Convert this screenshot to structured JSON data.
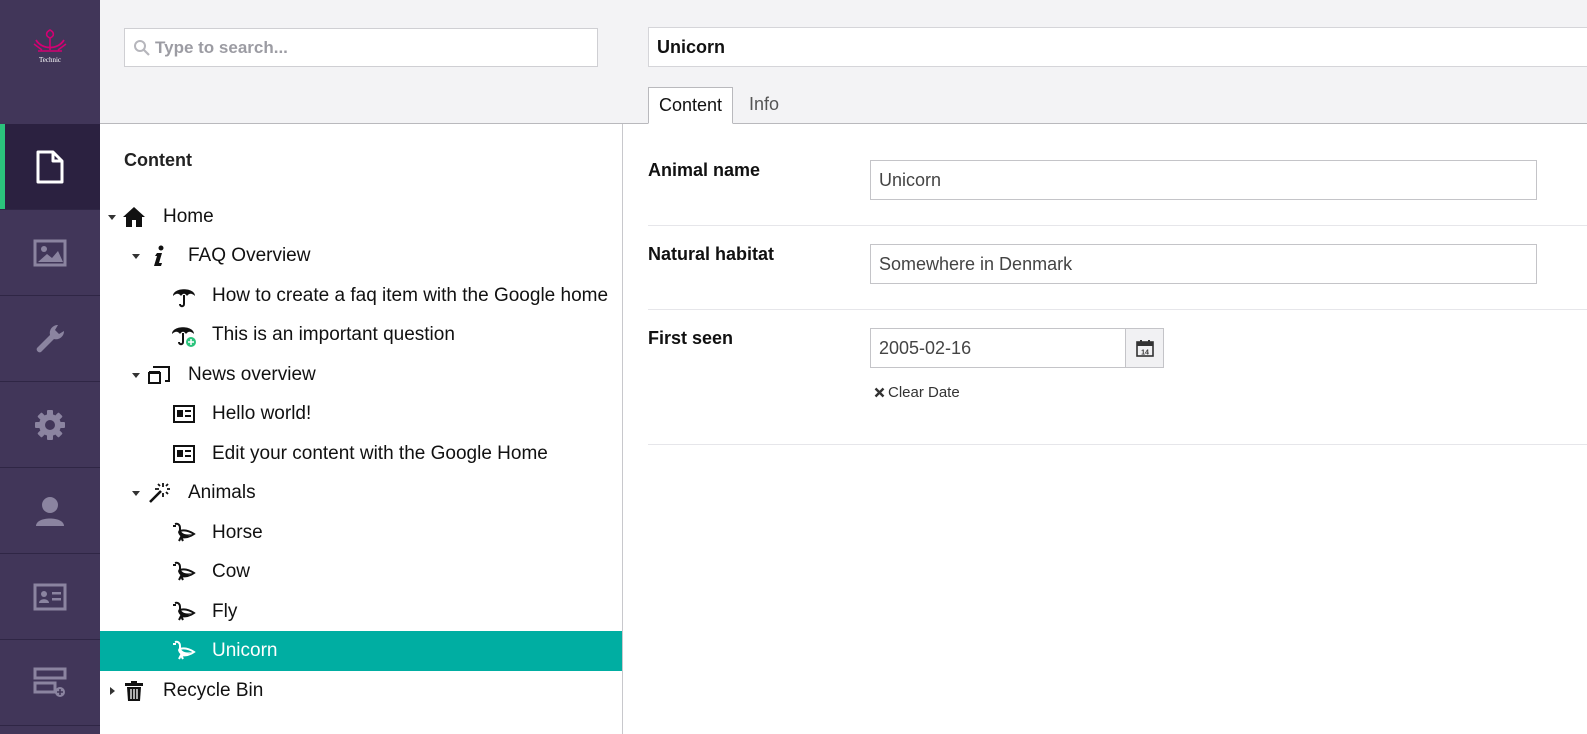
{
  "colors": {
    "sidebar_bg": "#413659",
    "sidebar_active_bg": "#2b2140",
    "accent": "#2bc37c",
    "selection": "#00aea2",
    "header_bg": "#f3f3f5",
    "logo": "#d40073"
  },
  "logo": {
    "text": "Technic",
    "icon": "logo-icon"
  },
  "sections": [
    {
      "icon": "document-icon",
      "active": true
    },
    {
      "icon": "image-icon",
      "active": false
    },
    {
      "icon": "wrench-icon",
      "active": false
    },
    {
      "icon": "gear-icon",
      "active": false
    },
    {
      "icon": "user-icon",
      "active": false
    },
    {
      "icon": "contact-card-icon",
      "active": false
    },
    {
      "icon": "add-form-icon",
      "active": false
    }
  ],
  "search": {
    "placeholder": "Type to search...",
    "icon": "search-icon"
  },
  "tree": {
    "title": "Content",
    "nodes": [
      {
        "label": "Home",
        "icon": "home-icon",
        "expanded": true
      },
      {
        "label": "FAQ Overview",
        "icon": "info-icon",
        "expanded": true
      },
      {
        "label": "How to create a faq item with the Google home",
        "icon": "umbrella-icon"
      },
      {
        "label": "This is an important question",
        "icon": "umbrella-icon"
      },
      {
        "label": "News overview",
        "icon": "window-icon",
        "expanded": true
      },
      {
        "label": "Hello world!",
        "icon": "newspaper-icon"
      },
      {
        "label": "Edit your content with the Google Home",
        "icon": "newspaper-icon"
      },
      {
        "label": "Animals",
        "icon": "wand-icon",
        "expanded": true
      },
      {
        "label": "Horse",
        "icon": "bird-icon"
      },
      {
        "label": "Cow",
        "icon": "bird-icon"
      },
      {
        "label": "Fly",
        "icon": "bird-icon"
      },
      {
        "label": "Unicorn",
        "icon": "bird-icon",
        "selected": true
      },
      {
        "label": "Recycle Bin",
        "icon": "trash-icon",
        "expanded": false
      }
    ]
  },
  "editor": {
    "node_name": "Unicorn",
    "tabs": [
      "Content",
      "Info"
    ],
    "active_tab": "Content",
    "properties": [
      {
        "label": "Animal name",
        "value": "Unicorn"
      },
      {
        "label": "Natural habitat",
        "value": "Somewhere in Denmark"
      },
      {
        "label": "First seen",
        "value": "2005-02-16"
      }
    ],
    "calendar_day": "14",
    "clear_date_label": "Clear Date"
  }
}
